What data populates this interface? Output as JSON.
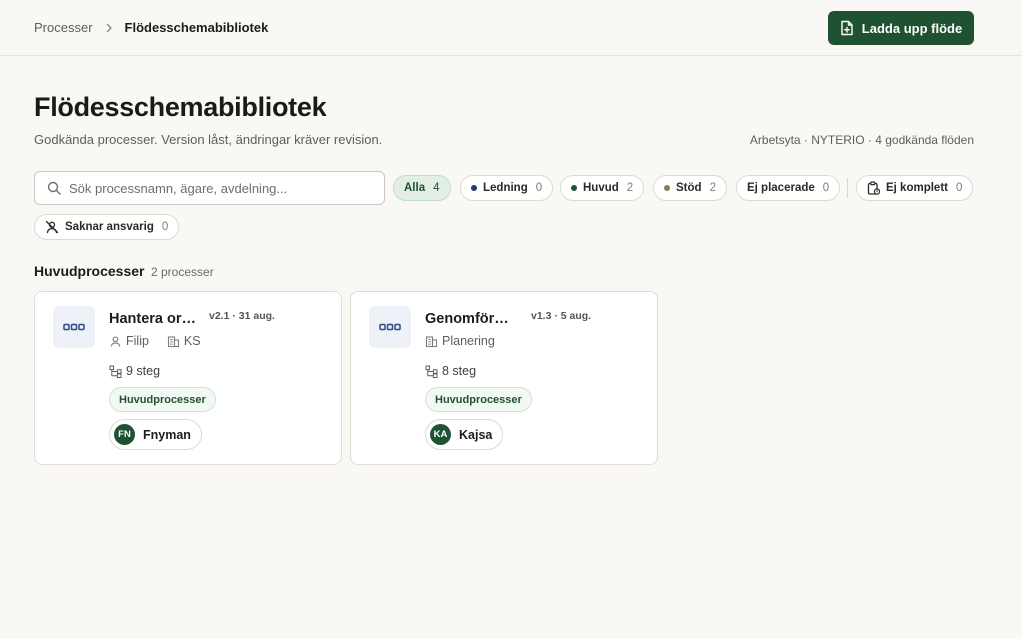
{
  "breadcrumb": {
    "parent": "Processer",
    "current": "Flödesschemabibliotek"
  },
  "header": {
    "upload_label": "Ladda upp flöde"
  },
  "page": {
    "title": "Flödesschemabibliotek",
    "subtitle": "Godkända processer. Version låst, ändringar kräver revision.",
    "meta": "Arbetsyta · NYTERIO · 4 godkända flöden"
  },
  "search": {
    "placeholder": "Sök processnamn, ägare, avdelning...",
    "value": ""
  },
  "filters": [
    {
      "label": "Alla",
      "count": "4",
      "active": true
    },
    {
      "label": "Ledning",
      "count": "0",
      "dot": "#1e3a6e"
    },
    {
      "label": "Huvud",
      "count": "2",
      "dot": "#1f5232"
    },
    {
      "label": "Stöd",
      "count": "2",
      "dot": "#8a7a5a"
    },
    {
      "label": "Ej placerade",
      "count": "0"
    },
    {
      "label": "Ej komplett",
      "count": "0",
      "icon": "clipboard-alert-icon"
    },
    {
      "label": "Saknar ansvarig",
      "count": "0",
      "icon": "user-off-icon"
    }
  ],
  "section": {
    "title": "Huvudprocesser",
    "count": "2 processer"
  },
  "cards": [
    {
      "title": "Hantera order",
      "version": "v2.1 · 31 aug.",
      "owner_short": "Filip",
      "department": "KS",
      "steps": "9 steg",
      "tag": "Huvudprocesser",
      "owner_initials": "FN",
      "owner_name": "Fnyman"
    },
    {
      "title": "Genomföra planering",
      "version": "v1.3 · 5 aug.",
      "department": "Planering",
      "steps": "8 steg",
      "tag": "Huvudprocesser",
      "owner_initials": "KA",
      "owner_name": "Kajsa"
    }
  ],
  "colors": {
    "accent": "#1f5232",
    "background": "#f9f8f5",
    "card_icon_bg": "#eef1f7",
    "card_icon_fg": "#2b4a86"
  }
}
